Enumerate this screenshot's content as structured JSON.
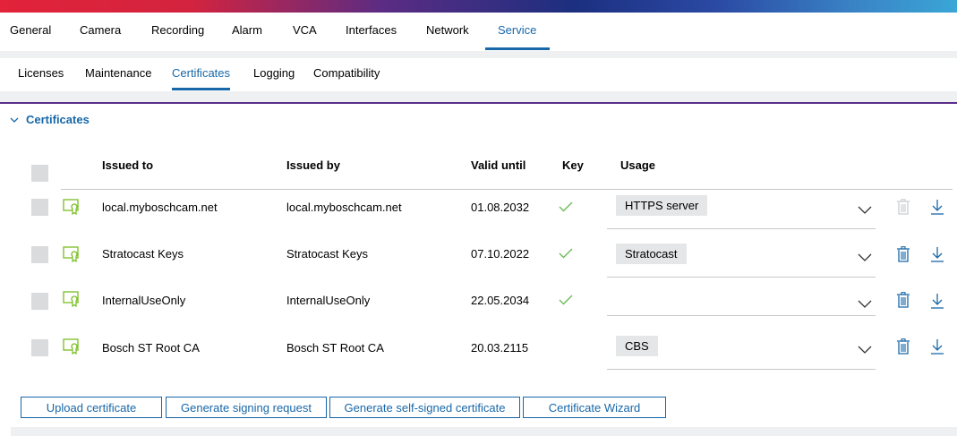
{
  "top_nav": {
    "items": [
      "General",
      "Camera",
      "Recording",
      "Alarm",
      "VCA",
      "Interfaces",
      "Network",
      "Service"
    ],
    "active": "Service"
  },
  "sub_nav": {
    "items": [
      "Licenses",
      "Maintenance",
      "Certificates",
      "Logging",
      "Compatibility"
    ],
    "active": "Certificates"
  },
  "section": {
    "title": "Certificates"
  },
  "table": {
    "headers": {
      "issued_to": "Issued to",
      "issued_by": "Issued by",
      "valid_until": "Valid until",
      "key": "Key",
      "usage": "Usage"
    },
    "rows": [
      {
        "issued_to": "local.myboschcam.net",
        "issued_by": "local.myboschcam.net",
        "valid_until": "01.08.2032",
        "key": true,
        "usage": "HTTPS server",
        "delete_enabled": false
      },
      {
        "issued_to": "Stratocast Keys",
        "issued_by": "Stratocast Keys",
        "valid_until": "07.10.2022",
        "key": true,
        "usage": "Stratocast",
        "delete_enabled": true
      },
      {
        "issued_to": "InternalUseOnly",
        "issued_by": "InternalUseOnly",
        "valid_until": "22.05.2034",
        "key": true,
        "usage": "",
        "delete_enabled": true
      },
      {
        "issued_to": "Bosch ST Root CA",
        "issued_by": "Bosch ST Root CA",
        "valid_until": "20.03.2115",
        "key": false,
        "usage": "CBS",
        "delete_enabled": true
      }
    ]
  },
  "buttons": {
    "upload": "Upload certificate",
    "generate_request": "Generate signing request",
    "generate_self_signed": "Generate self-signed certificate",
    "wizard": "Certificate Wizard"
  },
  "icons": {
    "section_toggle": "chevron-down-icon",
    "certificate": "certificate-icon",
    "key_present": "check-icon",
    "usage_dropdown": "chevron-down-icon",
    "delete": "trash-icon",
    "download": "download-icon"
  },
  "colors": {
    "accent": "#1867a8",
    "section_rule": "#5a2e8a",
    "check": "#6dbb5a",
    "cert_icon": "#78be20",
    "disabled": "#c9ccd0"
  }
}
